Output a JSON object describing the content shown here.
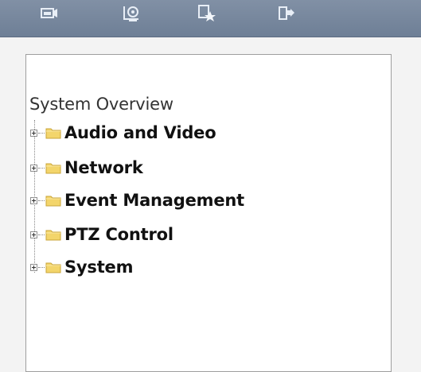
{
  "toolbar": {
    "icons": [
      "live-view-icon",
      "playback-icon",
      "favorites-icon",
      "logout-icon"
    ]
  },
  "tree": {
    "root_label": "System Overview",
    "items": [
      {
        "label": "Audio and Video",
        "icon": "folder-icon",
        "expander": "plus"
      },
      {
        "label": "Network",
        "icon": "folder-icon",
        "expander": "plus"
      },
      {
        "label": "Event Management",
        "icon": "folder-icon",
        "expander": "plus"
      },
      {
        "label": "PTZ Control",
        "icon": "folder-icon",
        "expander": "plus"
      },
      {
        "label": "System",
        "icon": "folder-icon",
        "expander": "plus"
      }
    ]
  },
  "colors": {
    "toolbar_bg": "#7a8aa0",
    "folder": "#f3d56b",
    "panel_bg": "#ffffff",
    "page_bg": "#f3f3f3"
  }
}
